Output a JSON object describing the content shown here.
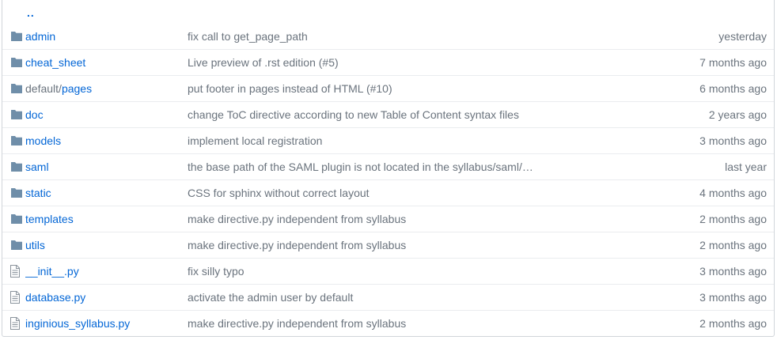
{
  "up_link": {
    "label": ".."
  },
  "rows": [
    {
      "type": "dir",
      "prefix": "",
      "name": "admin",
      "message": "fix call to get_page_path",
      "age": "yesterday"
    },
    {
      "type": "dir",
      "prefix": "",
      "name": "cheat_sheet",
      "message": "Live preview of .rst edition (#5)",
      "age": "7 months ago"
    },
    {
      "type": "dir",
      "prefix": "default/",
      "name": "pages",
      "message": "put footer in pages instead of HTML (#10)",
      "age": "6 months ago"
    },
    {
      "type": "dir",
      "prefix": "",
      "name": "doc",
      "message": "change ToC directive according to new Table of Content syntax files",
      "age": "2 years ago"
    },
    {
      "type": "dir",
      "prefix": "",
      "name": "models",
      "message": "implement local registration",
      "age": "3 months ago"
    },
    {
      "type": "dir",
      "prefix": "",
      "name": "saml",
      "message": "the base path of the SAML plugin is not located in the syllabus/saml/…",
      "age": "last year"
    },
    {
      "type": "dir",
      "prefix": "",
      "name": "static",
      "message": "CSS for sphinx without correct layout",
      "age": "4 months ago"
    },
    {
      "type": "dir",
      "prefix": "",
      "name": "templates",
      "message": "make directive.py independent from syllabus",
      "age": "2 months ago"
    },
    {
      "type": "dir",
      "prefix": "",
      "name": "utils",
      "message": "make directive.py independent from syllabus",
      "age": "2 months ago"
    },
    {
      "type": "file",
      "prefix": "",
      "name": "__init__.py",
      "message": "fix silly typo",
      "age": "3 months ago"
    },
    {
      "type": "file",
      "prefix": "",
      "name": "database.py",
      "message": "activate the admin user by default",
      "age": "3 months ago"
    },
    {
      "type": "file",
      "prefix": "",
      "name": "inginious_syllabus.py",
      "message": "make directive.py independent from syllabus",
      "age": "2 months ago"
    }
  ],
  "colors": {
    "link": "#0366d6",
    "muted": "#6a737d",
    "folder_icon": "#79b8ff",
    "file_icon": "#6a737d",
    "border": "#eaecef"
  },
  "icons": {
    "dir": "folder-icon",
    "file": "file-icon"
  }
}
